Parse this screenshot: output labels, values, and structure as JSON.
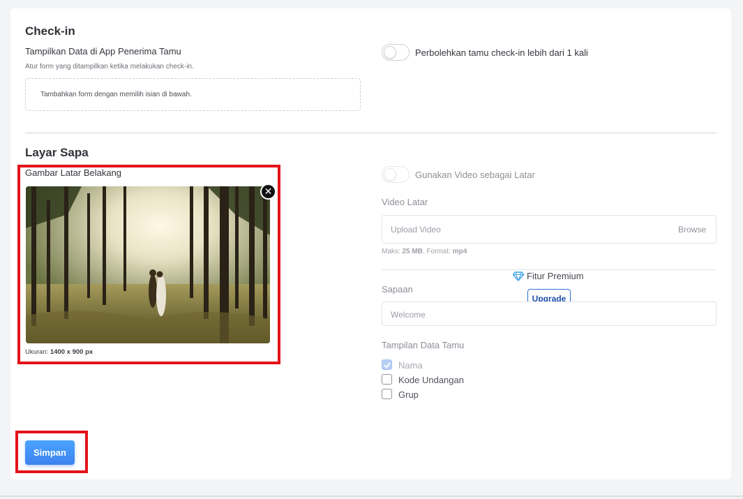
{
  "checkin": {
    "title": "Check-in",
    "display_label": "Tampilkan Data di App Penerima Tamu",
    "display_help": "Atur form yang ditampilkan ketika melakukan check-in.",
    "dropzone_text": "Tambahkan form dengan memilih isian di bawah.",
    "multi_checkin_label": "Perbolehkan tamu check-in lebih dari 1 kali",
    "multi_checkin_enabled": false
  },
  "layar_sapa": {
    "title": "Layar Sapa",
    "bg_image_label": "Gambar Latar Belakang",
    "size_prefix": "Ukuran: ",
    "size_value": "1400 x 900 px",
    "use_video_label": "Gunakan Video sebagai Latar",
    "use_video_enabled": false,
    "video_label": "Video Latar",
    "upload_placeholder": "Upload Video",
    "browse_label": "Browse",
    "video_help_max_prefix": "Maks: ",
    "video_help_max_value": "25 MB",
    "video_help_format_prefix": ". Format: ",
    "video_help_format_value": "mp4",
    "premium_label": "Fitur Premium",
    "upgrade_label": "Upgrade",
    "greeting_label": "Sapaan",
    "greeting_placeholder": "Welcome",
    "guest_data_label": "Tampilan Data Tamu",
    "guest_fields": [
      {
        "label": "Nama",
        "checked": true,
        "disabled": true
      },
      {
        "label": "Kode Undangan",
        "checked": false,
        "disabled": false
      },
      {
        "label": "Grup",
        "checked": false,
        "disabled": false
      }
    ]
  },
  "save_label": "Simpan",
  "colors": {
    "primary": "#3d82f0",
    "highlight": "#e4121a",
    "premium_icon": "#3aa0e8"
  },
  "icons": {
    "close": "close-icon",
    "premium": "diamond-icon",
    "check": "check-icon"
  }
}
